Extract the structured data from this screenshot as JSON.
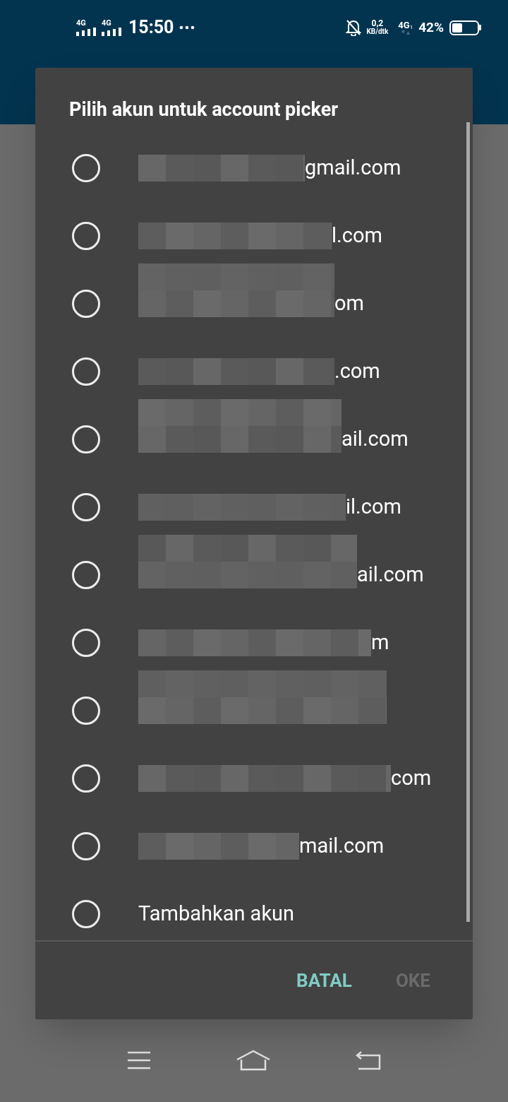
{
  "status_bar": {
    "sim_1": "4G",
    "sim_2": "4G",
    "time": "15:50",
    "speed_value": "0,2",
    "speed_unit": "KB/dtk",
    "network": "4G",
    "network_sim": "1",
    "battery": "42%"
  },
  "dialog": {
    "title": "Pilih akun untuk account picker",
    "options": [
      {
        "kind": "account",
        "label": "gmail.com",
        "selected": false
      },
      {
        "kind": "account",
        "label": "l.com",
        "selected": false
      },
      {
        "kind": "account",
        "label": "om",
        "selected": false
      },
      {
        "kind": "account",
        "label": ".com",
        "selected": false
      },
      {
        "kind": "account",
        "label": "ail.com",
        "selected": false
      },
      {
        "kind": "account",
        "label": "il.com",
        "selected": false
      },
      {
        "kind": "account",
        "label": "ail.com",
        "selected": false
      },
      {
        "kind": "account",
        "label": "m",
        "selected": false
      },
      {
        "kind": "account",
        "selected": false
      },
      {
        "kind": "account",
        "label": "com",
        "selected": false
      },
      {
        "kind": "account",
        "label": "mail.com",
        "selected": false
      },
      {
        "kind": "add",
        "label": "Tambahkan akun",
        "selected": false
      }
    ],
    "buttons": [
      {
        "label": "BATAL",
        "disabled": false
      },
      {
        "label": "OKE",
        "disabled": true
      }
    ]
  }
}
